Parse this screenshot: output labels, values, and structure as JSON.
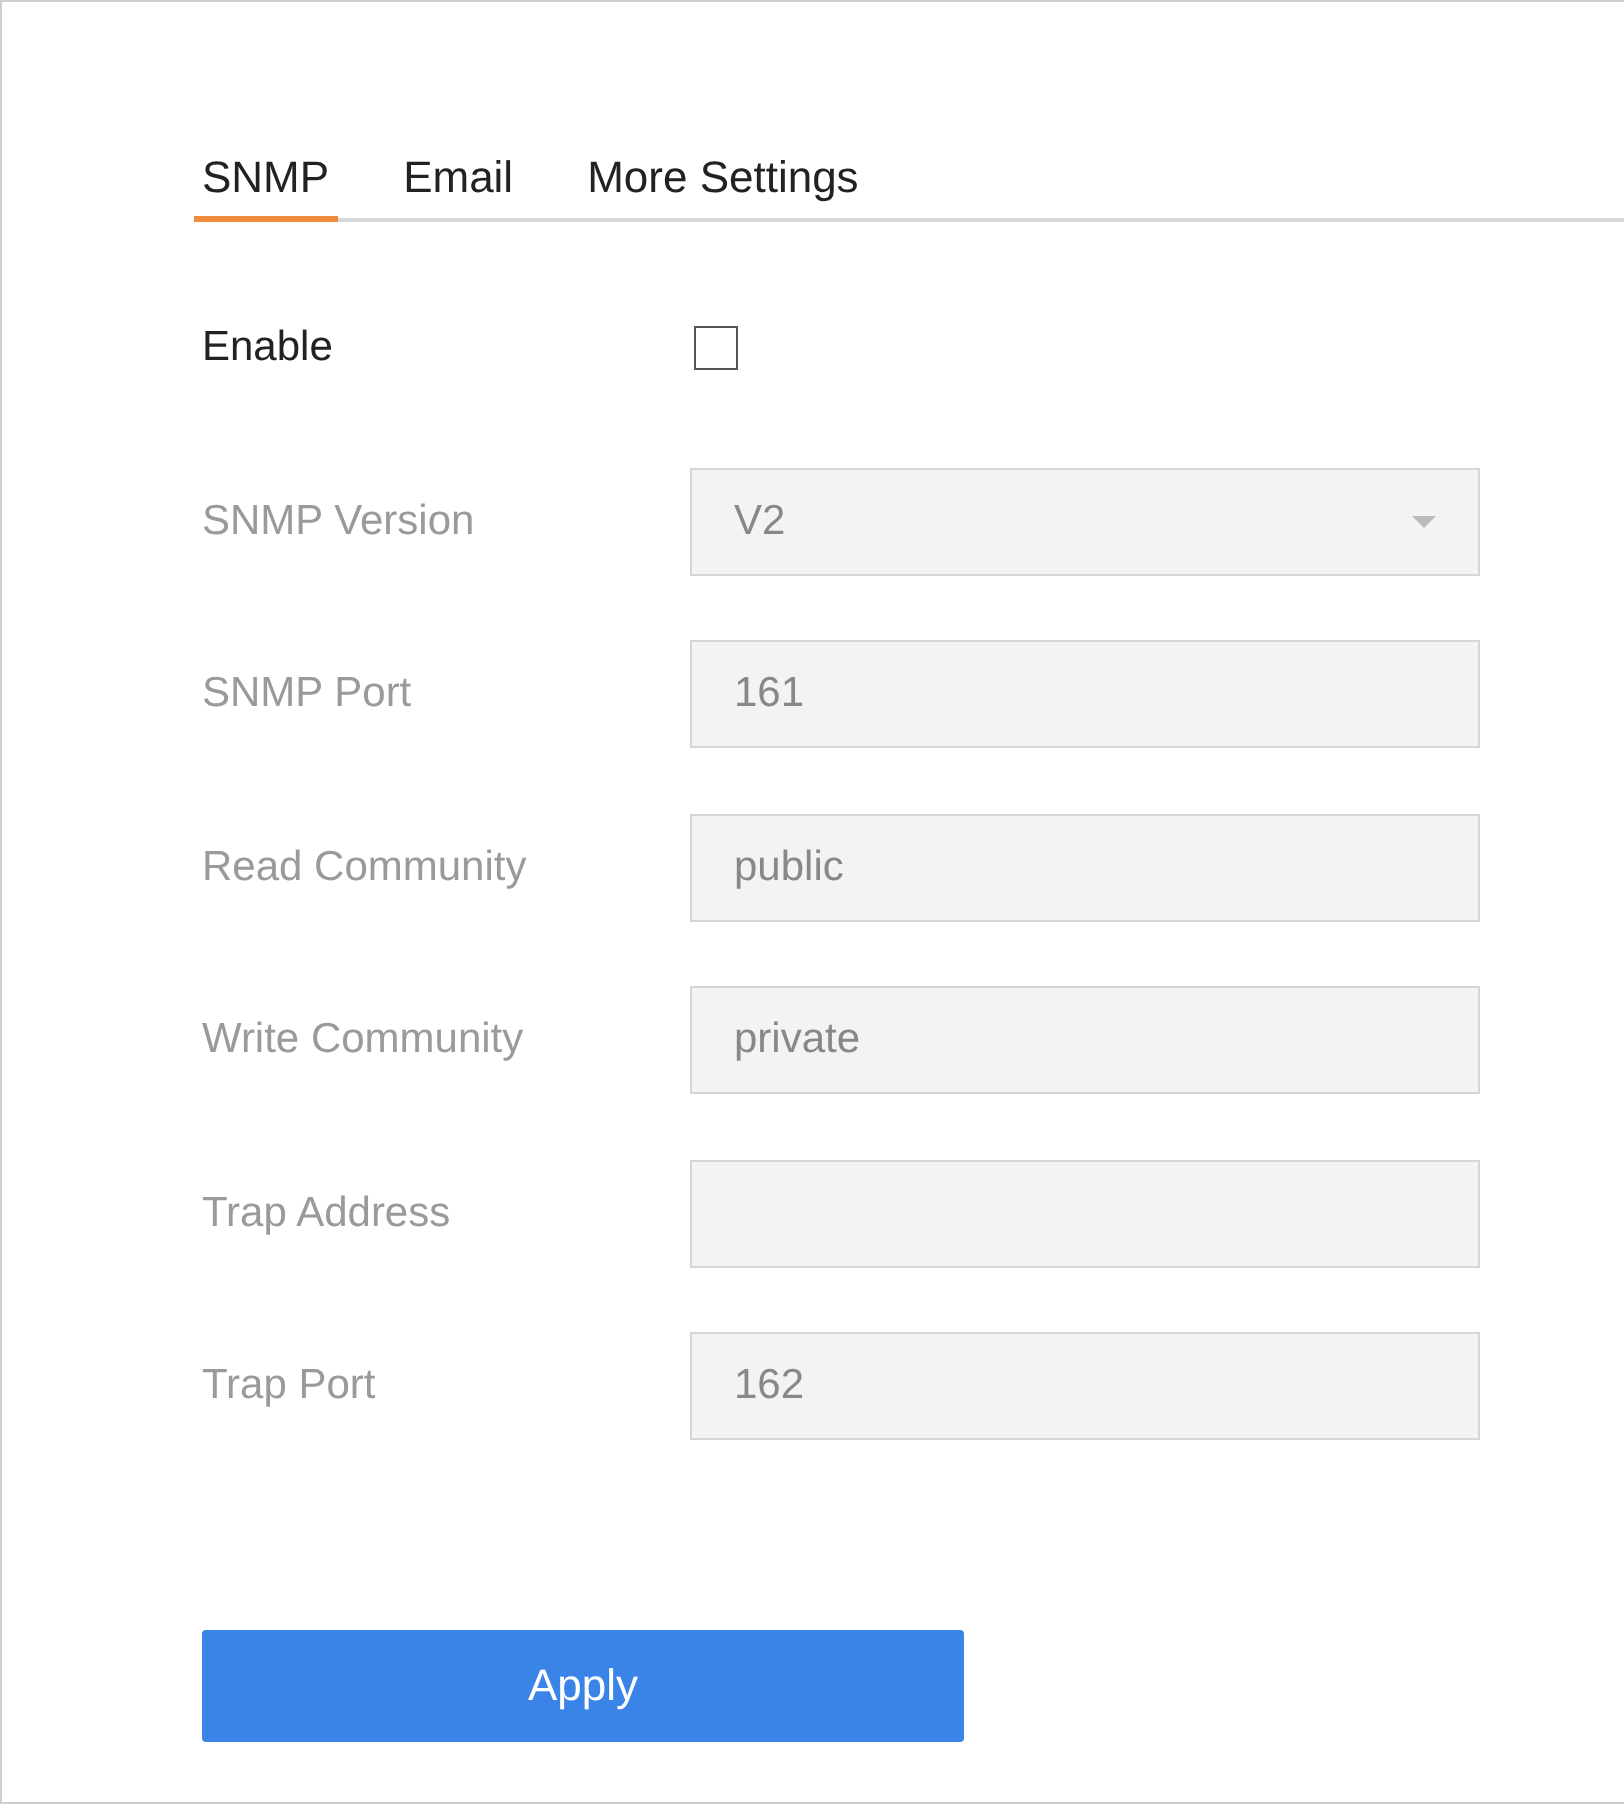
{
  "tabs": [
    {
      "label": "SNMP",
      "selected": true
    },
    {
      "label": "Email",
      "selected": false
    },
    {
      "label": "More Settings",
      "selected": false
    }
  ],
  "enable": {
    "label": "Enable",
    "checked": false
  },
  "fields": [
    {
      "label": "SNMP Version",
      "kind": "dropdown",
      "value": "V2",
      "disabled": true
    },
    {
      "label": "SNMP Port",
      "kind": "text",
      "value": "161",
      "disabled": true
    },
    {
      "label": "Read Community",
      "kind": "text",
      "value": "public",
      "disabled": true
    },
    {
      "label": "Write Community",
      "kind": "text",
      "value": "private",
      "disabled": true
    },
    {
      "label": "Trap Address",
      "kind": "text",
      "disabled": true
    },
    {
      "label": "Trap Port",
      "kind": "text",
      "value": "162",
      "disabled": true
    }
  ],
  "apply_button": {
    "label": "Apply"
  }
}
